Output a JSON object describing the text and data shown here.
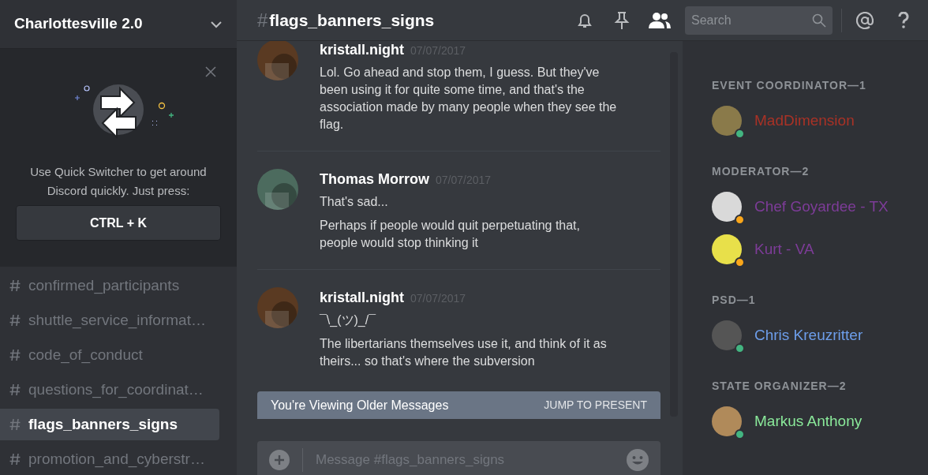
{
  "server": {
    "name": "Charlottesville 2.0"
  },
  "quick_switcher": {
    "text": "Use Quick Switcher to get around Discord quickly. Just press:",
    "shortcut": "CTRL + K"
  },
  "channels": [
    {
      "name": "confirmed_participants",
      "selected": false
    },
    {
      "name": "shuttle_service_informat…",
      "selected": false
    },
    {
      "name": "code_of_conduct",
      "selected": false
    },
    {
      "name": "questions_for_coordinat…",
      "selected": false
    },
    {
      "name": "flags_banners_signs",
      "selected": true
    },
    {
      "name": "promotion_and_cyberstr…",
      "selected": false
    }
  ],
  "header": {
    "hash": "#",
    "channel": "flags_banners_signs",
    "search_placeholder": "Search"
  },
  "messages": [
    {
      "author": "kristall.night",
      "time": "07/07/2017",
      "lines": [
        "Lol. Go ahead and stop them, I guess. But they've been using it for quite some time, and that's the association made by many people when they see the flag."
      ]
    },
    {
      "author": "Thomas Morrow",
      "time": "07/07/2017",
      "lines": [
        "That's sad...",
        "Perhaps if people would quit perpetuating that, people would stop thinking it"
      ]
    },
    {
      "author": "kristall.night",
      "time": "07/07/2017",
      "lines": [
        "¯\\_(ツ)_/¯",
        "The libertarians themselves use it, and think of it as theirs... so that's where the subversion"
      ]
    }
  ],
  "older_banner": {
    "text": "You're Viewing Older Messages",
    "action": "JUMP TO PRESENT"
  },
  "composer": {
    "placeholder": "Message #flags_banners_signs"
  },
  "member_groups": [
    {
      "title": "EVENT COORDINATOR—1",
      "members": [
        {
          "name": "MadDimension",
          "color": "#a93226",
          "idle": false
        }
      ]
    },
    {
      "title": "MODERATOR—2",
      "members": [
        {
          "name": "Chef Goyardee - TX",
          "color": "#7d3c98",
          "idle": true
        },
        {
          "name": "Kurt - VA",
          "color": "#7d3c98",
          "idle": true
        }
      ]
    },
    {
      "title": "PSD—1",
      "members": [
        {
          "name": "Chris Kreuzritter",
          "color": "#6d9eeb",
          "idle": false
        }
      ]
    },
    {
      "title": "STATE ORGANIZER—2",
      "members": [
        {
          "name": "Markus Anthony",
          "color": "#8ae99a",
          "idle": false
        }
      ]
    }
  ]
}
